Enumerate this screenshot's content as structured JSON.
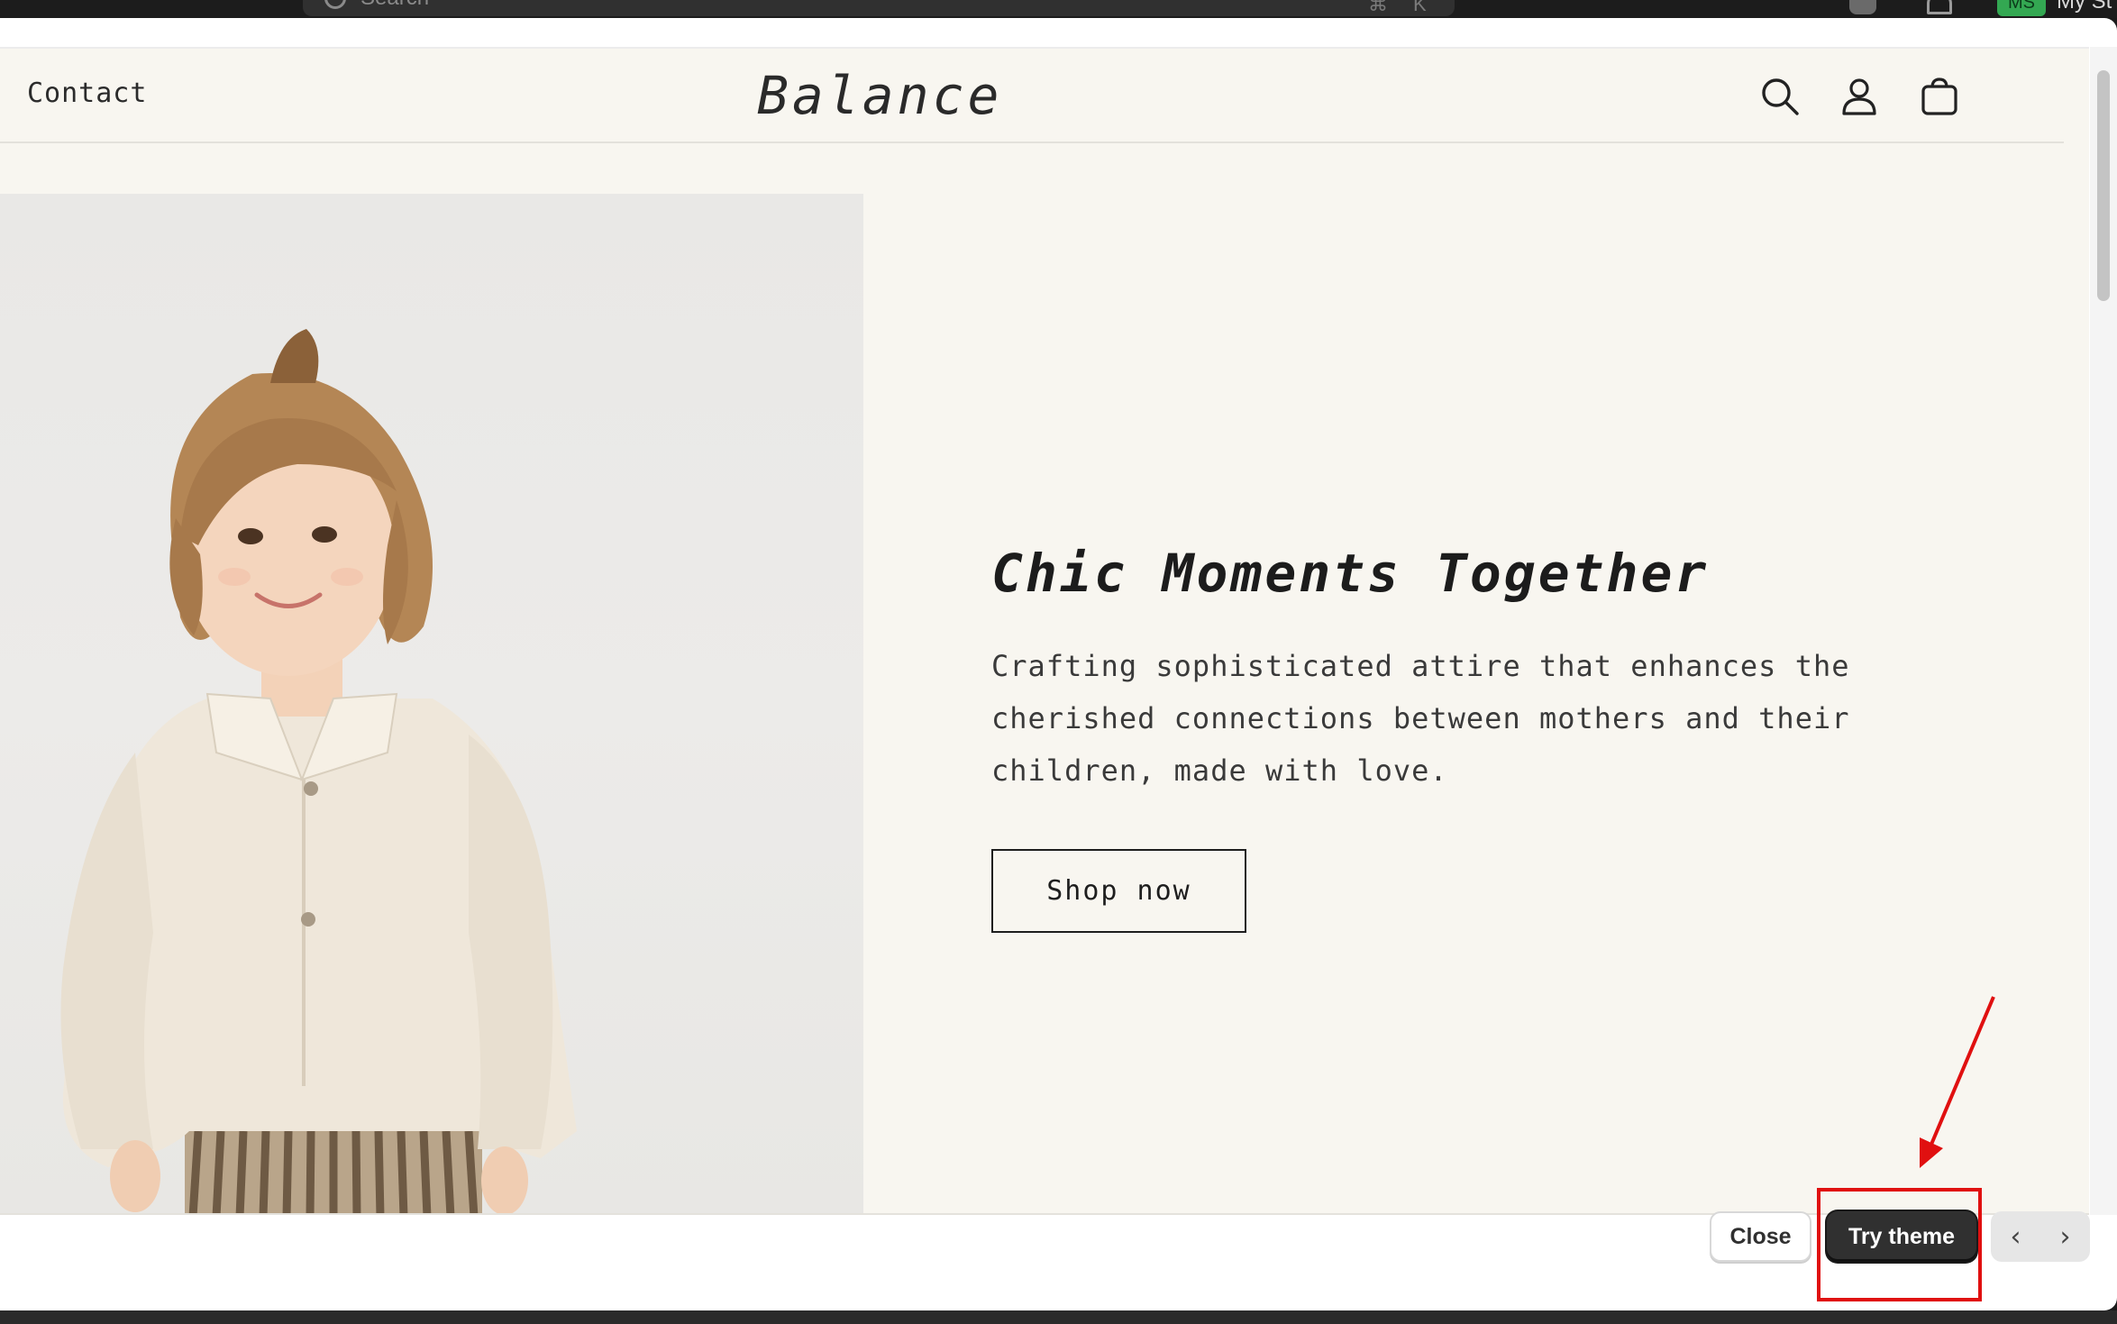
{
  "topbar": {
    "search_placeholder": "Search",
    "shortcut_cmd": "⌘",
    "shortcut_key": "K",
    "store_initials": "MS",
    "store_name": "My St"
  },
  "storefront": {
    "nav_contact": "Contact",
    "logo": "Balance",
    "header_icons": [
      "search-icon",
      "account-icon",
      "cart-icon"
    ],
    "hero": {
      "title": "Chic Moments Together",
      "text": "Crafting sophisticated attire that enhances the cherished connections between mothers and their children, made with love.",
      "cta": "Shop now"
    }
  },
  "footer": {
    "close_label": "Close",
    "try_theme_label": "Try theme",
    "prev_label": "‹",
    "next_label": "›"
  },
  "colors": {
    "highlight": "#e01010",
    "storefront_bg": "#f8f6f0",
    "button_dark": "#303030"
  }
}
